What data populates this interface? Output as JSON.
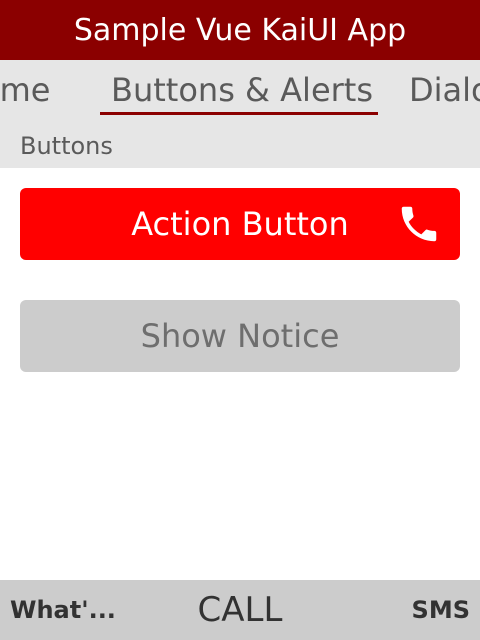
{
  "header": {
    "title": "Sample Vue KaiUI App"
  },
  "tabs": [
    {
      "label": "Home",
      "visible_text": "ome"
    },
    {
      "label": "Buttons & Alerts",
      "visible_text": "Buttons & Alerts",
      "active": true
    },
    {
      "label": "Dialogs",
      "visible_text": "Dialo"
    }
  ],
  "section": {
    "title": "Buttons"
  },
  "buttons": {
    "action": {
      "label": "Action Button",
      "icon": "phone-icon",
      "color": "#ff0000"
    },
    "notice": {
      "label": "Show Notice"
    }
  },
  "softkeys": {
    "left": "What'...",
    "center": "CALL",
    "right": "SMS"
  },
  "colors": {
    "brand": "#8b0000",
    "accent": "#ff0000",
    "bar_bg": "#e6e6e6",
    "softkey_bg": "#cccccc"
  }
}
